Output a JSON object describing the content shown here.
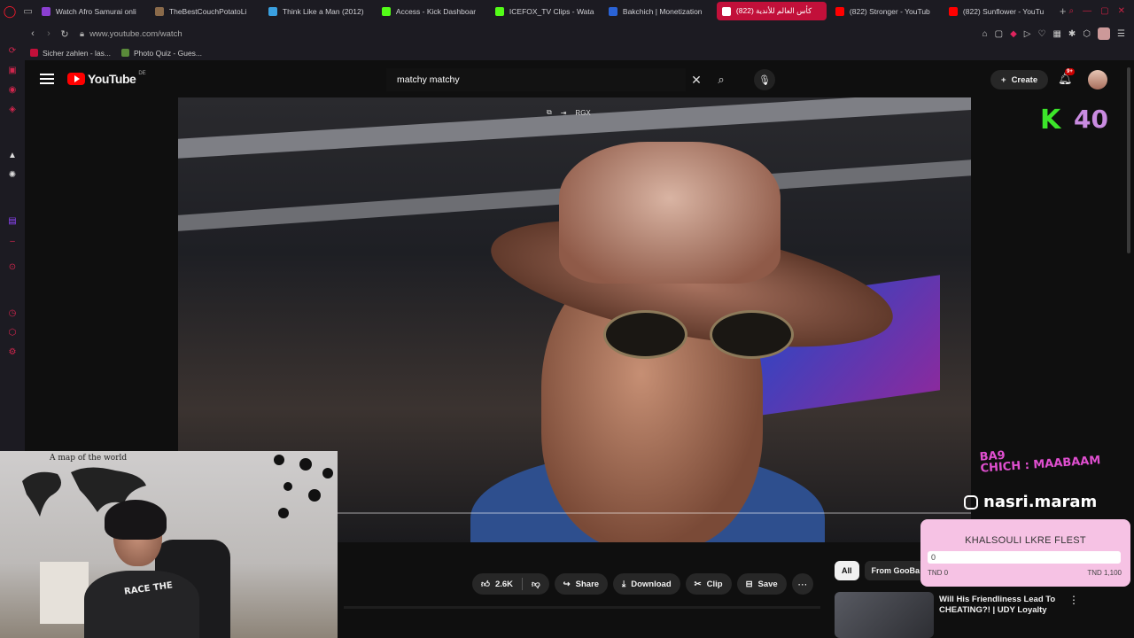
{
  "browser": {
    "tabs": [
      {
        "label": "Watch Afro Samurai onli",
        "color": "#8b3fd1"
      },
      {
        "label": "TheBestCouchPotatoLi",
        "color": "#8a6a4a"
      },
      {
        "label": "Think Like a Man (2012)",
        "color": "#3aa0e0"
      },
      {
        "label": "Access - Kick Dashboar",
        "color": "#53fc18"
      },
      {
        "label": "ICEFOX_TV Clips - Wata",
        "color": "#53fc18"
      },
      {
        "label": "Bakchich | Monetization",
        "color": "#2a63d6"
      },
      {
        "label": "كأس العالم للأندية (822)",
        "color": "#ff0000",
        "active": true
      },
      {
        "label": "(822) Stronger - YouTub",
        "color": "#ff0000"
      },
      {
        "label": "(822) Sunflower - YouTu",
        "color": "#ff0000"
      }
    ],
    "url": "www.youtube.com/watch",
    "bookmarks": [
      {
        "label": "Sicher zahlen - las...",
        "color": "#c2103a"
      },
      {
        "label": "Photo Quiz - Gues...",
        "color": "#5a8a3a"
      }
    ]
  },
  "youtube": {
    "logo_text": "YouTube",
    "region": "DE",
    "search": {
      "value": "matchy matchy",
      "placeholder": "Search"
    },
    "create_label": "Create",
    "notification_badge": "9+"
  },
  "player": {
    "top_label": "RGX",
    "overlay": {
      "k_count": "40",
      "ba9_line1": "BA9",
      "ba9_line2": "CHICH : MAABAAM",
      "instagram": "nasri.maram"
    }
  },
  "webcam": {
    "map_title": "A map of the world",
    "shirt_text": "RACE THE"
  },
  "actions": {
    "likes": "2.6K",
    "share": "Share",
    "download": "Download",
    "clip": "Clip",
    "save": "Save"
  },
  "sidebar_chips": {
    "all": "All",
    "from": "From GooBa"
  },
  "related": {
    "title": "Will His Friendliness Lead To CHEATING?! | UDY Loyalty Test"
  },
  "goal": {
    "title": "KHALSOULI LKRE FLEST",
    "current": "0",
    "min_label": "TND 0",
    "max_label": "TND 1,100",
    "progress": 0
  },
  "colors": {
    "accent": "#c2103a",
    "youtube_red": "#ff0000",
    "kick_green": "#3ce52a",
    "goal_bg": "#f6c2e4"
  }
}
